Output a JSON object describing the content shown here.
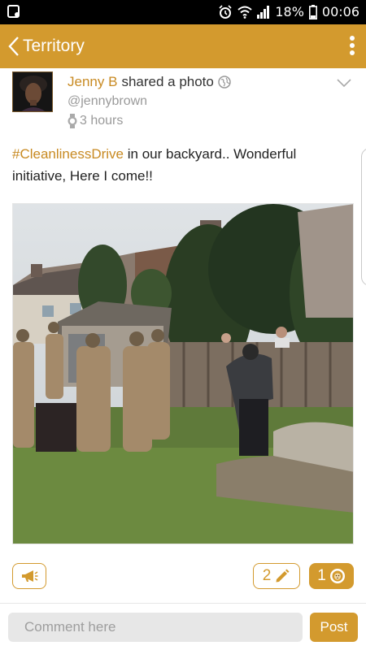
{
  "status_bar": {
    "battery_percent": "18%",
    "time": "00:06",
    "icons": [
      "notification-icon",
      "alarm-icon",
      "wifi-icon",
      "signal-icon",
      "battery-icon"
    ]
  },
  "app_bar": {
    "title": "Territory",
    "icons": [
      "back-chevron-icon",
      "more-vert-icon"
    ]
  },
  "post": {
    "author": "Jenny B",
    "action": "shared a photo",
    "handle": "@jennybrown",
    "time_ago": "3 hours",
    "hashtag": "#CleanlinessDrive",
    "caption_rest": " in our backyard.. Wonderful initiative, Here I come!!",
    "photo_alt": "Photo of volunteers in coveralls clearing a backyard",
    "icons": [
      "globe-icon",
      "watch-icon",
      "chevron-down-icon"
    ]
  },
  "actions": {
    "comments_count": "2",
    "likes_count": "1",
    "icons": [
      "megaphone-icon",
      "pencil-icon",
      "lion-badge-icon"
    ]
  },
  "comment": {
    "placeholder": "Comment here",
    "post_label": "Post"
  },
  "colors": {
    "accent": "#d39a2e",
    "status_bar": "#000000",
    "hashtag": "#c88a22"
  }
}
